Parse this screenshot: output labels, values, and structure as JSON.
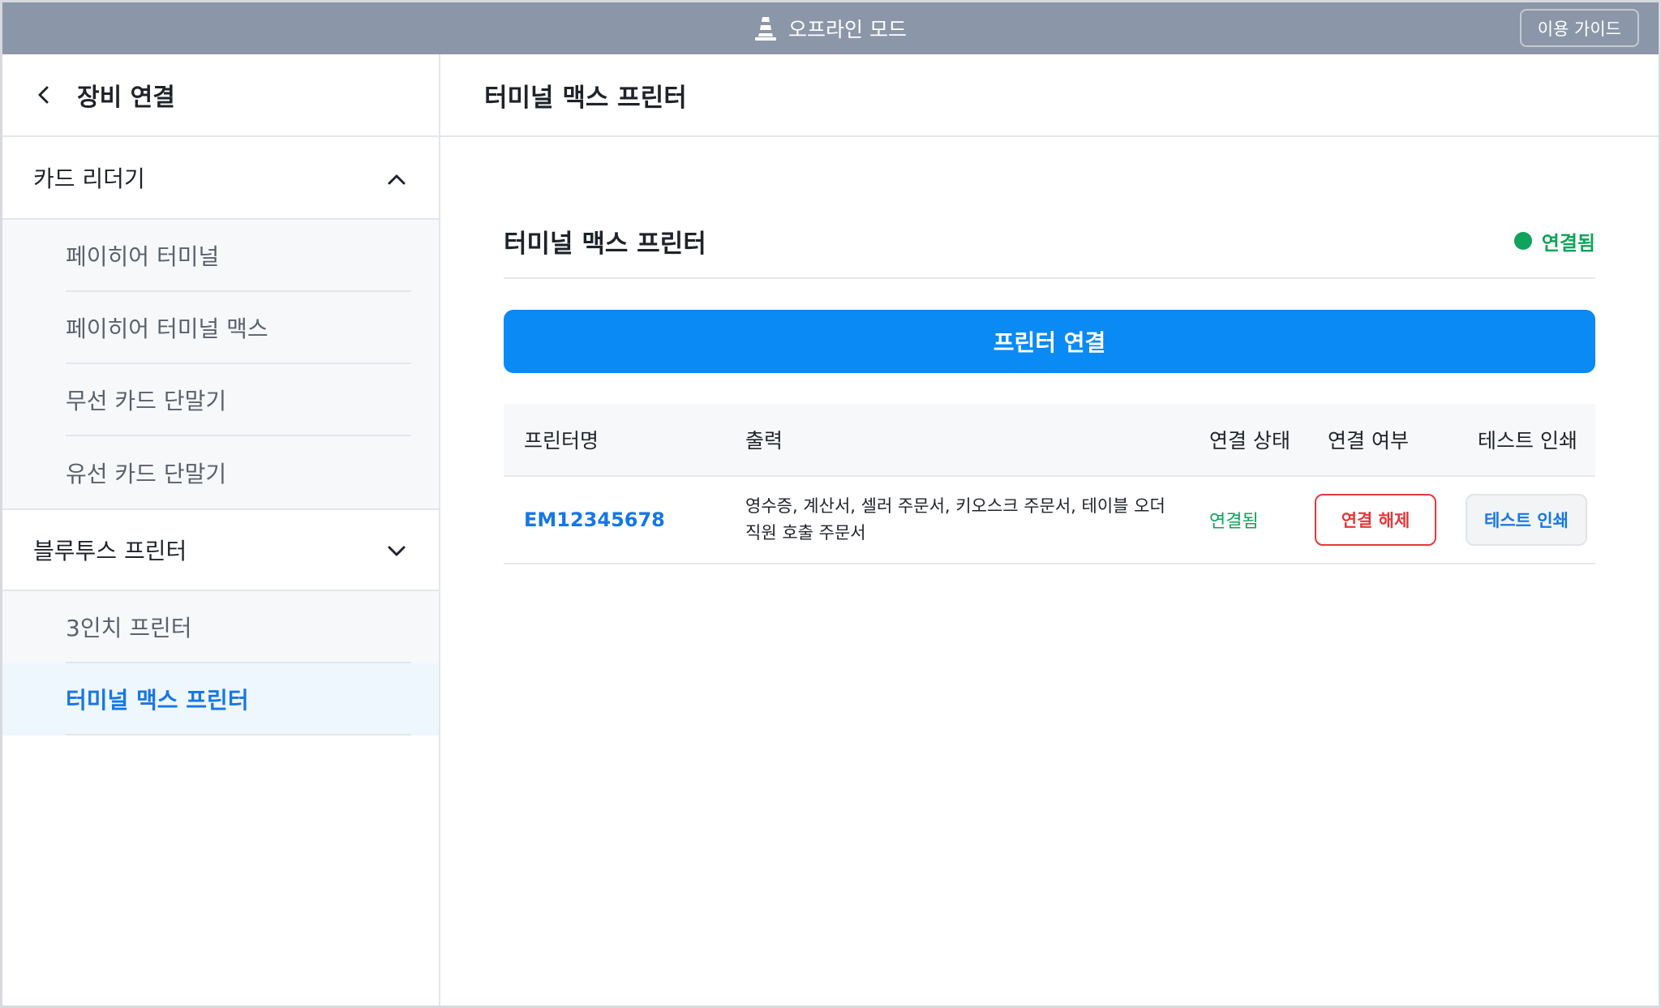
{
  "topbar": {
    "mode_icon": "traffic-cone-icon",
    "mode_label": "오프라인 모드",
    "guide_label": "이용 가이드"
  },
  "sidebar": {
    "back_icon": "chevron-left-icon",
    "title": "장비 연결",
    "groups": [
      {
        "label": "카드 리더기",
        "expanded": true,
        "icon": "chevron-up-icon",
        "items": [
          {
            "label": "페이히어 터미널"
          },
          {
            "label": "페이히어 터미널 맥스"
          },
          {
            "label": "무선 카드 단말기"
          },
          {
            "label": "유선 카드 단말기"
          }
        ]
      },
      {
        "label": "블루투스 프린터",
        "expanded": true,
        "icon": "chevron-down-icon",
        "items": [
          {
            "label": "3인치 프린터"
          },
          {
            "label": "터미널 맥스 프린터",
            "active": true
          }
        ]
      }
    ]
  },
  "main": {
    "header_title": "터미널 맥스 프린터",
    "device": {
      "name": "터미널 맥스 프린터",
      "status": "연결됨",
      "status_color": "#10a35a"
    },
    "connect_button": "프린터 연결",
    "table": {
      "headers": [
        "프린터명",
        "출력",
        "연결 상태",
        "연결 여부",
        "테스트 인쇄"
      ],
      "rows": [
        {
          "name": "EM12345678",
          "output_line1": "영수증, 계산서, 셀러 주문서, 키오스크 주문서, 테이블 오더",
          "output_line2": "직원 호출 주문서",
          "status": "연결됨",
          "disconnect_label": "연결 해제",
          "test_label": "테스트 인쇄"
        }
      ]
    }
  },
  "colors": {
    "topbar": "#8b97a8",
    "primary": "#0a8af5",
    "link": "#1677e6",
    "success": "#10a35a",
    "danger": "#e5383b"
  }
}
